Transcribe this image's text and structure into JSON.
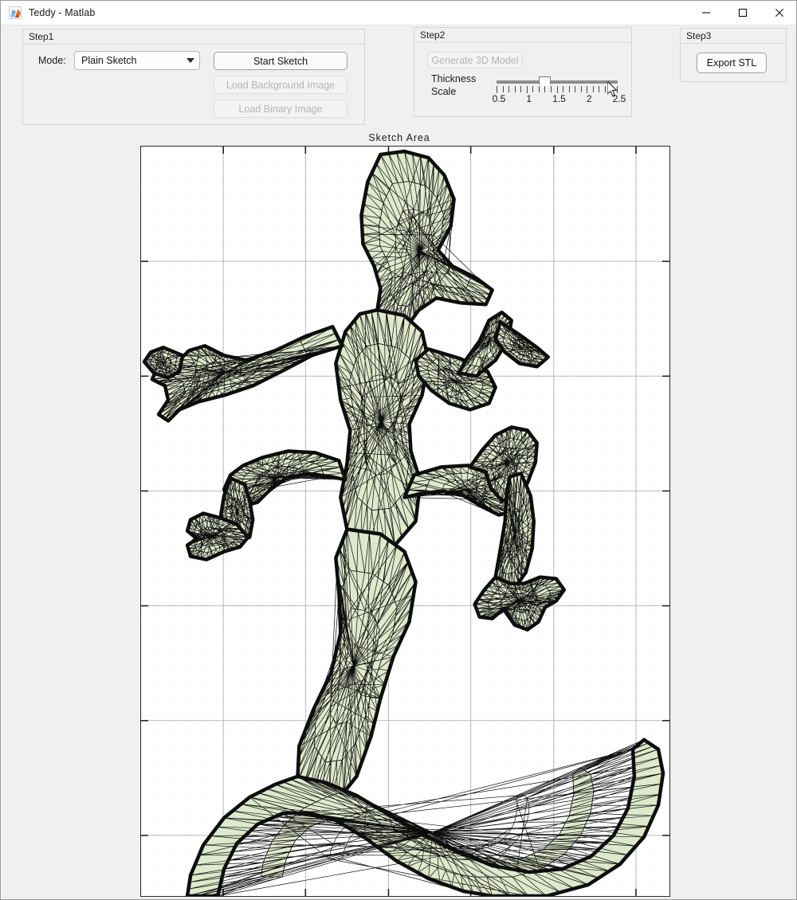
{
  "window": {
    "title": "Teddy - Matlab",
    "icon": "matlab-membrane-icon",
    "buttons": {
      "minimize": "minimize-icon",
      "maximize": "maximize-icon",
      "close": "close-icon"
    }
  },
  "step1": {
    "title": "Step1",
    "mode_label": "Mode:",
    "mode_value": "Plain Sketch",
    "mode_options": [
      "Plain Sketch"
    ],
    "start_sketch": "Start Sketch",
    "load_background": "Load Background Image",
    "load_binary": "Load Binary Image"
  },
  "step2": {
    "title": "Step2",
    "generate_model": "Generate 3D Model",
    "thickness_line1": "Thickness",
    "thickness_line2": "Scale",
    "slider": {
      "min": 0.5,
      "max": 2.5,
      "value": 1.3,
      "tick_labels": [
        "0.5",
        "1",
        "1.5",
        "2",
        "2.5"
      ]
    }
  },
  "step3": {
    "title": "Step3",
    "export_stl": "Export STL"
  },
  "sketch": {
    "title": "Sketch Area",
    "mesh_fill": "#dee8cb",
    "mesh_edge": "#0d0d0d",
    "background": "#ffffff",
    "grid_major_color": "#b8b8b8",
    "grid_minor_color": "#d5d5d5"
  }
}
